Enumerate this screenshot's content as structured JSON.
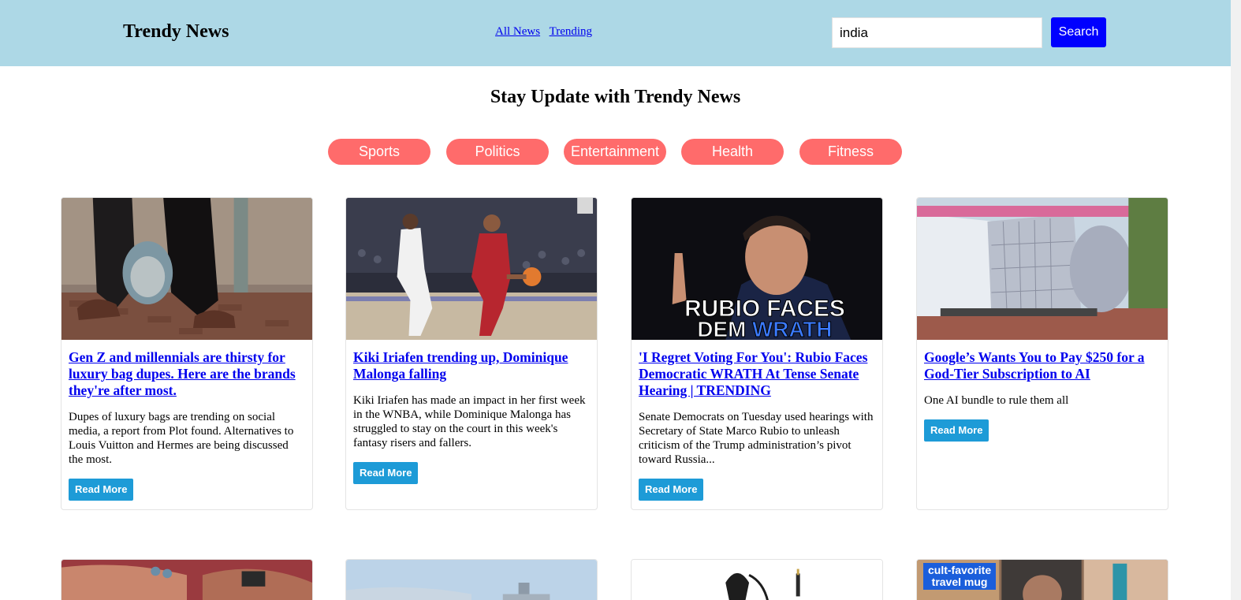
{
  "header": {
    "brand": "Trendy News",
    "nav": [
      "All News",
      "Trending"
    ],
    "search_value": "india",
    "search_button": "Search"
  },
  "hero_title": "Stay Update with Trendy News",
  "categories": [
    "Sports",
    "Politics",
    "Entertainment",
    "Health",
    "Fitness"
  ],
  "articles": [
    {
      "title": "Gen Z and millennials are thirsty for luxury bag dupes. Here are the brands they're after most.",
      "description": "Dupes of luxury bags are trending on social media, a report from Plot found. Alternatives to Louis Vuitton and Hermes are being discussed the most.",
      "button": "Read More"
    },
    {
      "title": "Kiki Iriafen trending up, Dominique Malonga falling",
      "description": "Kiki Iriafen has made an impact in her first week in the WNBA, while Dominique Malonga has struggled to stay on the court in this week's fantasy risers and fallers.",
      "button": "Read More"
    },
    {
      "title": "'I Regret Voting For You': Rubio Faces Democratic WRATH At Tense Senate Hearing | TRENDING",
      "description": "Senate Democrats on Tuesday used hearings with Secretary of State Marco Rubio to unleash criticism of the Trump administration’s pivot toward Russia...",
      "button": "Read More",
      "image_caption_line1": "RUBIO FACES",
      "image_caption_line2a": "DEM ",
      "image_caption_line2b": "WRATH"
    },
    {
      "title": "Google’s Wants You to Pay $250 for a God-Tier Subscription to AI",
      "description": "One AI bundle to rule them all",
      "button": "Read More"
    }
  ],
  "bottom_row": {
    "travel_tag_line1": "cult-favorite",
    "travel_tag_line2": "travel mug"
  },
  "colors": {
    "header_bg": "#add8e6",
    "pill_bg": "#ff6b6b",
    "search_button_bg": "#0000ff",
    "read_more_bg": "#1d9bd7",
    "link": "#0000ee"
  }
}
